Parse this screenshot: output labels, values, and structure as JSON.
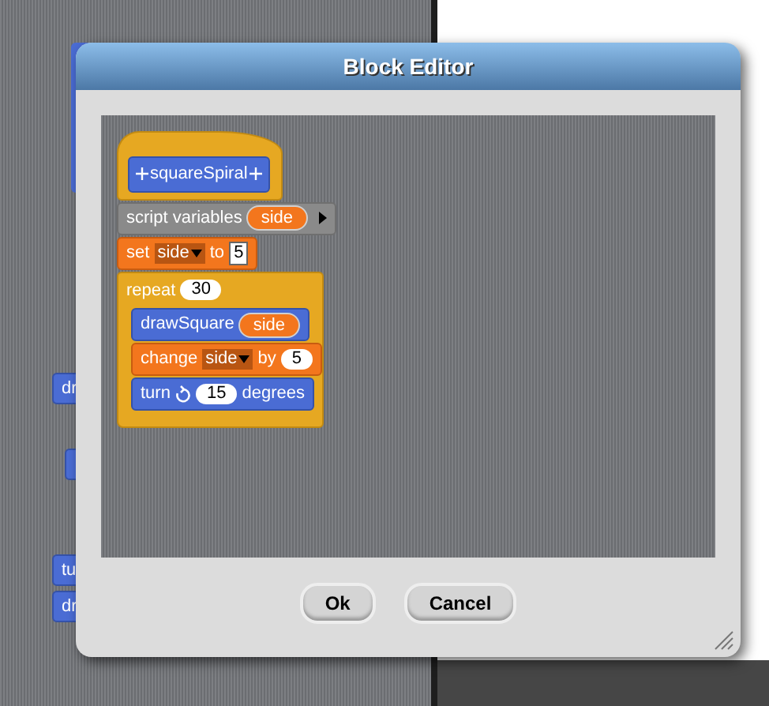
{
  "left_blocks": [
    {
      "kind": "label",
      "text": "dr"
    },
    {
      "kind": "plain"
    },
    {
      "kind": "label",
      "text": "tu"
    },
    {
      "kind": "label",
      "text": "dr"
    }
  ],
  "dialog": {
    "title": "Block Editor",
    "hat": {
      "label": "squareSpiral"
    },
    "blocks": [
      {
        "kind": "other",
        "parts": [
          {
            "kind": "text",
            "text": "script variables"
          },
          {
            "kind": "var",
            "text": "side"
          },
          {
            "kind": "arrow"
          }
        ]
      },
      {
        "kind": "variables",
        "parts": [
          {
            "kind": "text",
            "text": "set"
          },
          {
            "kind": "dropdown",
            "text": "side"
          },
          {
            "kind": "text",
            "text": "to"
          },
          {
            "kind": "square",
            "text": "5"
          }
        ]
      },
      {
        "kind": "control",
        "parts": [
          {
            "kind": "text",
            "text": "repeat"
          },
          {
            "kind": "number",
            "text": "30"
          }
        ],
        "children": [
          {
            "kind": "motion",
            "parts": [
              {
                "kind": "text",
                "text": "drawSquare"
              },
              {
                "kind": "var",
                "text": "side"
              }
            ]
          },
          {
            "kind": "variables",
            "parts": [
              {
                "kind": "text",
                "text": "change"
              },
              {
                "kind": "dropdown",
                "text": "side"
              },
              {
                "kind": "text",
                "text": "by"
              },
              {
                "kind": "number",
                "text": "5"
              }
            ]
          },
          {
            "kind": "motion",
            "parts": [
              {
                "kind": "text",
                "text": "turn"
              },
              {
                "kind": "rotate"
              },
              {
                "kind": "number",
                "text": "15"
              },
              {
                "kind": "text",
                "text": "degrees"
              }
            ]
          }
        ]
      }
    ],
    "buttons": [
      "Ok",
      "Cancel"
    ]
  }
}
